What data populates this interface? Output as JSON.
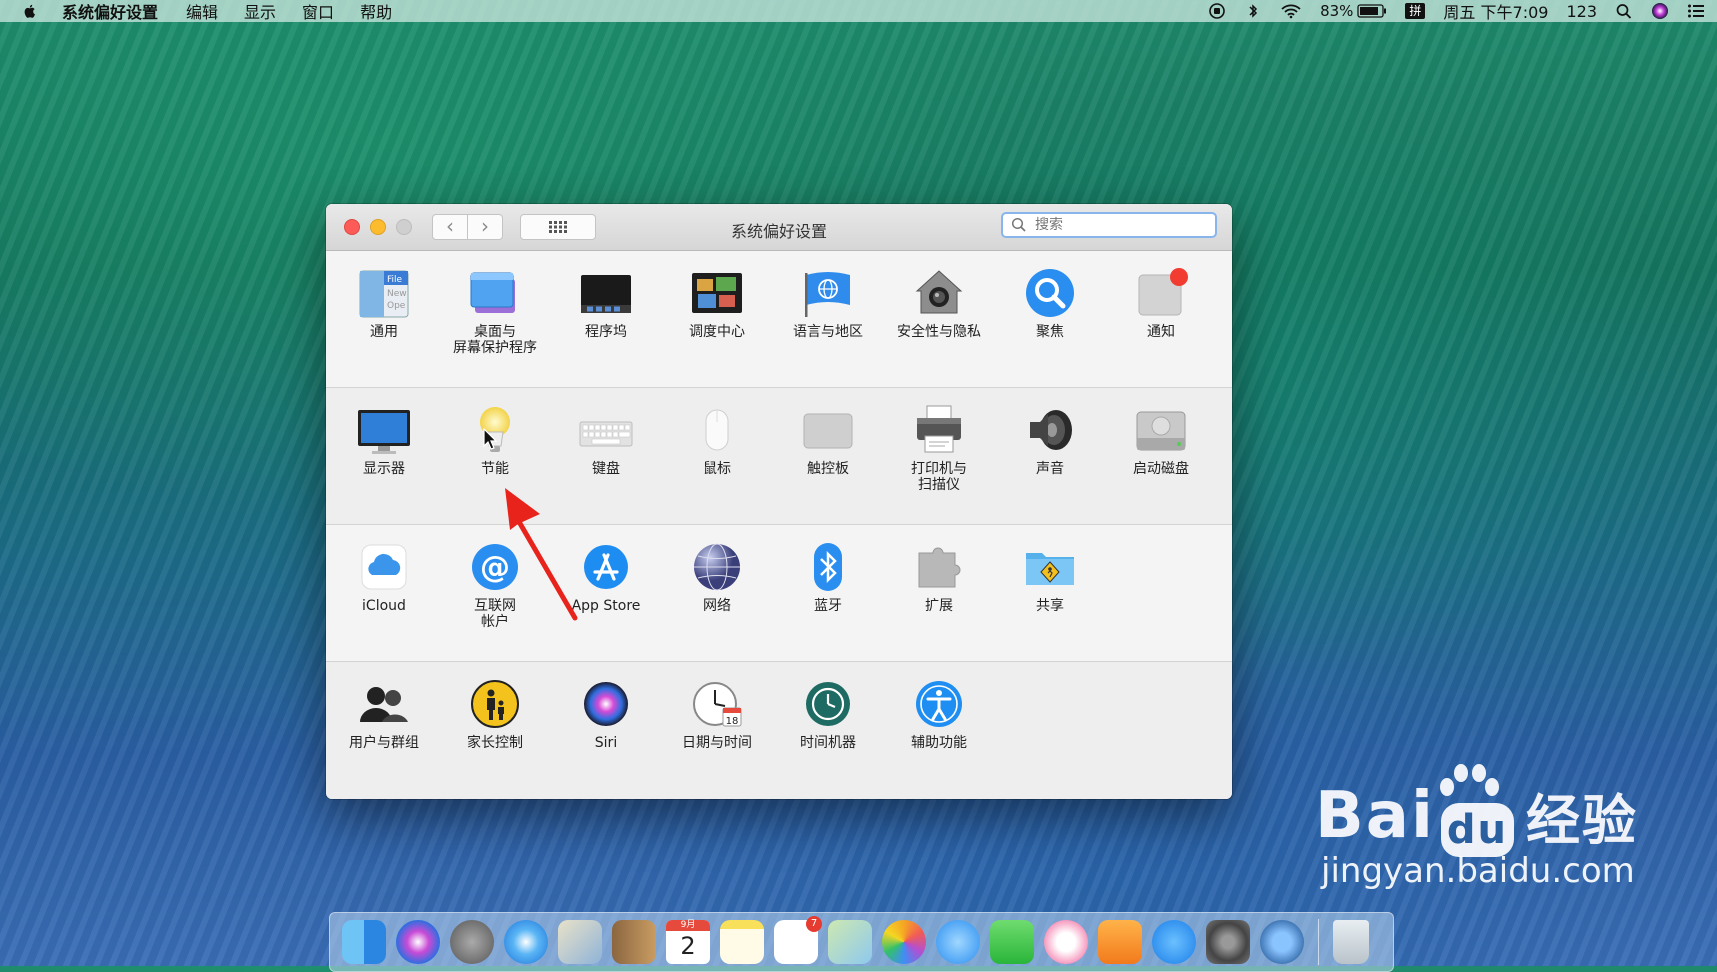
{
  "menubar": {
    "app": "系统偏好设置",
    "items": [
      "编辑",
      "显示",
      "窗口",
      "帮助"
    ],
    "battery": "83%",
    "ime": "拼",
    "clock": "周五 下午7:09",
    "user": "123"
  },
  "window": {
    "title": "系统偏好设置",
    "search_placeholder": "搜索",
    "rows": [
      [
        {
          "name": "general",
          "label": "通用",
          "icon": "general-file-icon"
        },
        {
          "name": "desktop",
          "label": "桌面与\n屏幕保护程序",
          "icon": "desktop-icon"
        },
        {
          "name": "dock",
          "label": "程序坞",
          "icon": "dock-icon"
        },
        {
          "name": "mission-control",
          "label": "调度中心",
          "icon": "mission-control-icon"
        },
        {
          "name": "language",
          "label": "语言与地区",
          "icon": "flag-globe-icon"
        },
        {
          "name": "security",
          "label": "安全性与隐私",
          "icon": "house-camera-icon"
        },
        {
          "name": "spotlight",
          "label": "聚焦",
          "icon": "magnifier-icon"
        },
        {
          "name": "notifications",
          "label": "通知",
          "icon": "notification-icon"
        }
      ],
      [
        {
          "name": "displays",
          "label": "显示器",
          "icon": "monitor-icon"
        },
        {
          "name": "energy",
          "label": "节能",
          "icon": "lightbulb-icon"
        },
        {
          "name": "keyboard",
          "label": "键盘",
          "icon": "keyboard-icon"
        },
        {
          "name": "mouse",
          "label": "鼠标",
          "icon": "mouse-icon"
        },
        {
          "name": "trackpad",
          "label": "触控板",
          "icon": "trackpad-icon"
        },
        {
          "name": "printers",
          "label": "打印机与\n扫描仪",
          "icon": "printer-icon"
        },
        {
          "name": "sound",
          "label": "声音",
          "icon": "speaker-icon"
        },
        {
          "name": "startup-disk",
          "label": "启动磁盘",
          "icon": "disk-icon"
        }
      ],
      [
        {
          "name": "icloud",
          "label": "iCloud",
          "icon": "cloud-icon"
        },
        {
          "name": "internet-accounts",
          "label": "互联网\n帐户",
          "icon": "at-icon"
        },
        {
          "name": "app-store",
          "label": "App Store",
          "icon": "app-store-icon"
        },
        {
          "name": "network",
          "label": "网络",
          "icon": "globe-icon"
        },
        {
          "name": "bluetooth",
          "label": "蓝牙",
          "icon": "bluetooth-icon"
        },
        {
          "name": "extensions",
          "label": "扩展",
          "icon": "puzzle-icon"
        },
        {
          "name": "sharing",
          "label": "共享",
          "icon": "sharing-folder-icon"
        }
      ],
      [
        {
          "name": "users",
          "label": "用户与群组",
          "icon": "users-icon"
        },
        {
          "name": "parental",
          "label": "家长控制",
          "icon": "parental-icon"
        },
        {
          "name": "siri",
          "label": "Siri",
          "icon": "siri-icon"
        },
        {
          "name": "date-time",
          "label": "日期与时间",
          "icon": "clock-calendar-icon"
        },
        {
          "name": "time-machine",
          "label": "时间机器",
          "icon": "time-machine-icon"
        },
        {
          "name": "accessibility",
          "label": "辅助功能",
          "icon": "accessibility-icon"
        }
      ]
    ]
  },
  "dock": {
    "icons": [
      "finder-icon",
      "siri-icon",
      "launchpad-icon",
      "safari-icon",
      "mail-icon",
      "contacts-icon",
      "calendar-icon",
      "notes-icon",
      "reminders-icon",
      "maps-icon",
      "photos-icon",
      "messages-icon",
      "facetime-icon",
      "itunes-icon",
      "ibooks-icon",
      "app-store-icon",
      "system-preferences-icon",
      "quicktime-icon",
      "trash-icon"
    ],
    "calendar_month": "9月",
    "calendar_day": "2",
    "reminders_badge": "7"
  },
  "watermark": {
    "main": "Bai",
    "paw": "du",
    "cn": "经验",
    "url": "jingyan.baidu.com"
  }
}
